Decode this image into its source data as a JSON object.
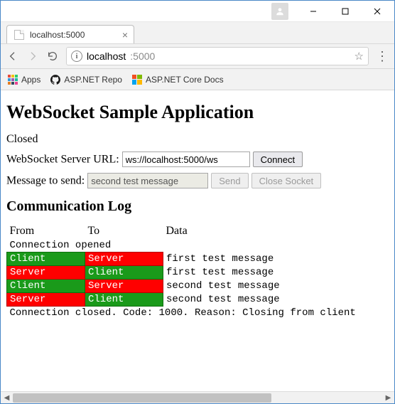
{
  "window": {
    "tab_title": "localhost:5000",
    "url_host": "localhost",
    "url_path": ":5000"
  },
  "bookmarks": {
    "apps_label": "Apps",
    "item1": "ASP.NET Repo",
    "item2": "ASP.NET Core Docs"
  },
  "page": {
    "h1": "WebSocket Sample Application",
    "status": "Closed",
    "url_label": "WebSocket Server URL:",
    "url_value": "ws://localhost:5000/ws",
    "connect_btn": "Connect",
    "msg_label": "Message to send:",
    "msg_value": "second test message",
    "send_btn": "Send",
    "close_btn": "Close Socket",
    "log_h2": "Communication Log",
    "cols": {
      "from": "From",
      "to": "To",
      "data": "Data"
    },
    "open_line": "Connection opened",
    "rows": [
      {
        "from": "Client",
        "to": "Server",
        "data": "first test message"
      },
      {
        "from": "Server",
        "to": "Client",
        "data": "first test message"
      },
      {
        "from": "Client",
        "to": "Server",
        "data": "second test message"
      },
      {
        "from": "Server",
        "to": "Client",
        "data": "second test message"
      }
    ],
    "close_line": "Connection closed. Code: 1000. Reason: Closing from client"
  },
  "colors": {
    "client": "#1a9a1a",
    "server": "#ff0000"
  }
}
